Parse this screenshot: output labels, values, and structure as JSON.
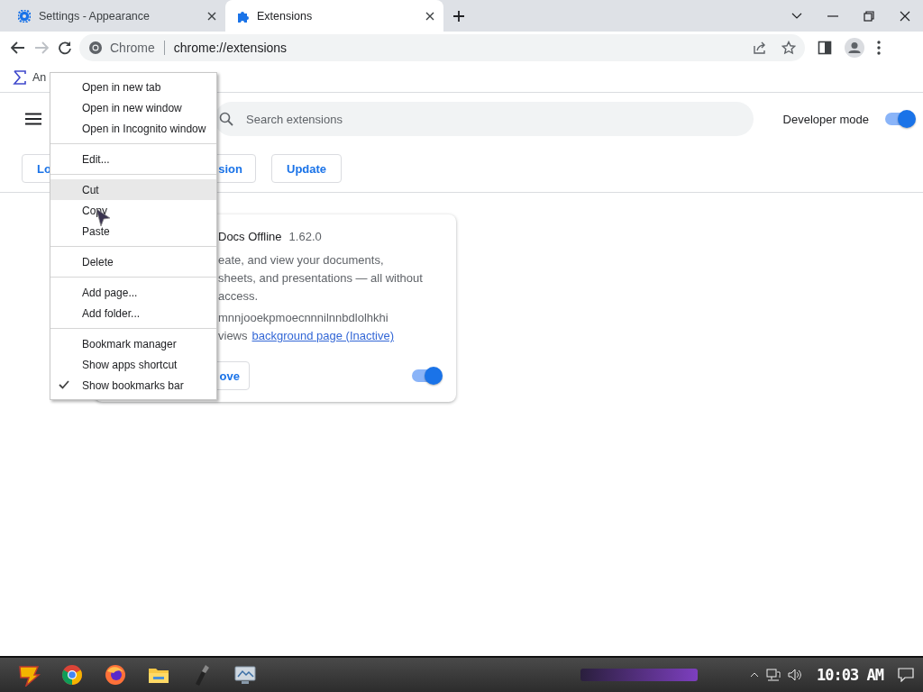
{
  "tabs": [
    {
      "title": "Settings - Appearance",
      "selected": false
    },
    {
      "title": "Extensions",
      "selected": true
    }
  ],
  "omnibox": {
    "chip": "Chrome",
    "url": "chrome://extensions"
  },
  "bookmarks": [
    {
      "label": "An"
    }
  ],
  "extensions_page": {
    "search": {
      "placeholder": "Search extensions"
    },
    "developer_mode": {
      "label": "Developer mode",
      "on": true
    },
    "buttons": [
      "Lo",
      "sion",
      "Update"
    ]
  },
  "extension_card": {
    "name": "Docs Offline",
    "version": "1.62.0",
    "description_lines": [
      "eate, and view your documents,",
      "sheets, and presentations — all without",
      "access."
    ],
    "id": "mnnjooekpmoecnnnilnnbdlolhkhi",
    "views_label": "views",
    "views_link": "background page (Inactive)",
    "remove_button": "ove",
    "enabled": true
  },
  "context_menu": {
    "groups": [
      [
        {
          "label": "Open in new tab",
          "highlighted": false,
          "checked": false
        },
        {
          "label": "Open in new window",
          "highlighted": false,
          "checked": false
        },
        {
          "label": "Open in Incognito window",
          "highlighted": false,
          "checked": false
        }
      ],
      [
        {
          "label": "Edit...",
          "highlighted": false,
          "checked": false
        }
      ],
      [
        {
          "label": "Cut",
          "highlighted": true,
          "checked": false
        },
        {
          "label": "Copy",
          "highlighted": false,
          "checked": false
        },
        {
          "label": "Paste",
          "highlighted": false,
          "checked": false
        }
      ],
      [
        {
          "label": "Delete",
          "highlighted": false,
          "checked": false
        }
      ],
      [
        {
          "label": "Add page...",
          "highlighted": false,
          "checked": false
        },
        {
          "label": "Add folder...",
          "highlighted": false,
          "checked": false
        }
      ],
      [
        {
          "label": "Bookmark manager",
          "highlighted": false,
          "checked": false
        },
        {
          "label": "Show apps shortcut",
          "highlighted": false,
          "checked": false
        },
        {
          "label": "Show bookmarks bar",
          "highlighted": false,
          "checked": true
        }
      ]
    ]
  },
  "taskbar": {
    "clock": "10:03 AM"
  }
}
